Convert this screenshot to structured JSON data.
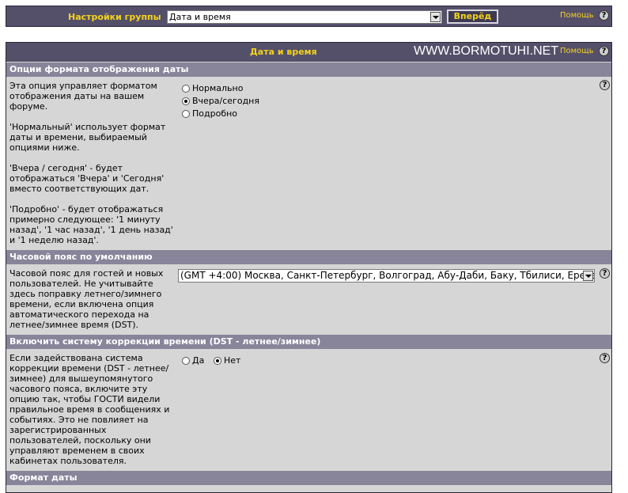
{
  "topbar": {
    "label": "Настройки группы",
    "group_select": "Дата и время",
    "go_button": "Вперёд",
    "help": "Помощь"
  },
  "panel": {
    "title": "Дата и время",
    "watermark": "WWW.BORMOTUHI.NET",
    "help": "Помощь"
  },
  "sections": {
    "date_format_display": {
      "title": "Опции формата отображения даты",
      "description": [
        "Эта опция управляет форматом отображения даты на вашем форуме.",
        "'Нормальный' использует формат даты и времени, выбираемый опциями ниже.",
        "'Вчера / сегодня' - будет отображаться 'Вчера' и 'Сегодня' вместо соответствующих дат.",
        "'Подробно' - будет отображаться примерно следующее: '1 минуту назад', '1 час назад', '1 день назад' и '1 неделю назад'."
      ],
      "options": [
        "Нормально",
        "Вчера/сегодня",
        "Подробно"
      ],
      "selected": "Вчера/сегодня"
    },
    "timezone": {
      "title": "Часовой пояс по умолчанию",
      "description": "Часовой пояс для гостей и новых пользователей. Не учитывайте здесь поправку летнего/зимнего времени, если включена опция автоматического перехода на летнее/зимнее время (DST).",
      "value": "(GMT +4:00) Москва, Санкт-Петербург, Волгоград, Абу-Даби, Баку, Тбилиси, Ереван"
    },
    "dst": {
      "title": "Включить систему коррекции времени (DST - летнее/зимнее)",
      "description": "Если задействована система коррекции времени (DST - летнее/зимнее) для вышеупомянутого часового пояса, включите эту опцию так, чтобы ГОСТИ видели правильное время в сообщениях и событиях. Это не повлияет на зарегистрированных пользователей, поскольку они управляют временем в своих кабинетах пользователя.",
      "options": [
        "Да",
        "Нет"
      ],
      "selected": "Нет"
    },
    "date_format": {
      "title": "Формат даты"
    }
  },
  "help_glyph": "?"
}
